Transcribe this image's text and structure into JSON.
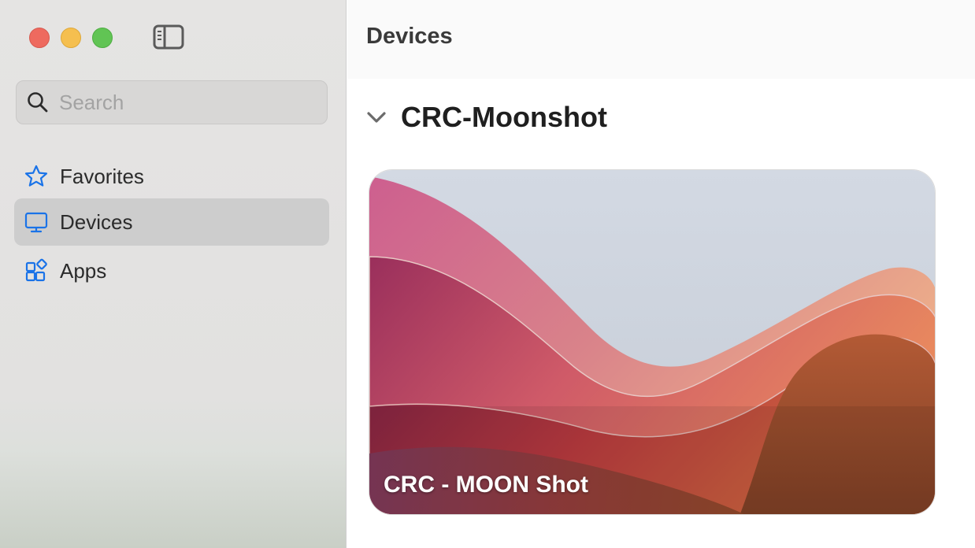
{
  "sidebar": {
    "search": {
      "placeholder": "Search",
      "value": ""
    },
    "items": [
      {
        "label": "Favorites",
        "icon": "star-icon",
        "selected": false
      },
      {
        "label": "Devices",
        "icon": "display-icon",
        "selected": true
      },
      {
        "label": "Apps",
        "icon": "apps-icon",
        "selected": false
      }
    ]
  },
  "header": {
    "title": "Devices"
  },
  "group": {
    "name": "CRC-Moonshot",
    "devices": [
      {
        "name": "CRC - MOON Shot"
      }
    ]
  },
  "colors": {
    "accent": "#1a73e8",
    "traffic_close": "#ee6a5f",
    "traffic_minimize": "#f5bf4f",
    "traffic_maximize": "#61c454"
  }
}
